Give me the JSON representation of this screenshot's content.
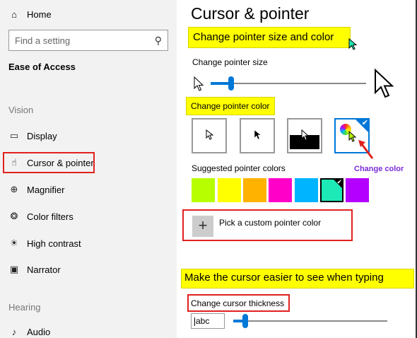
{
  "sidebar": {
    "home_label": "Home",
    "search_placeholder": "Find a setting",
    "category": "Ease of Access",
    "group_vision": "Vision",
    "items": [
      {
        "label": "Display",
        "icon": "monitor-icon"
      },
      {
        "label": "Cursor & pointer",
        "icon": "cursor-hand-icon"
      },
      {
        "label": "Magnifier",
        "icon": "magnifier-icon"
      },
      {
        "label": "Color filters",
        "icon": "color-filters-icon"
      },
      {
        "label": "High contrast",
        "icon": "high-contrast-icon"
      },
      {
        "label": "Narrator",
        "icon": "narrator-icon"
      }
    ],
    "group_hearing": "Hearing",
    "audio_label": "Audio",
    "audio_icon": "speaker-icon"
  },
  "main": {
    "title": "Cursor & pointer",
    "section_pointer": "Change pointer size and color",
    "size_label": "Change pointer size",
    "size_level": 0.13,
    "color_label": "Change pointer color",
    "color_options": [
      "white",
      "black",
      "inverted",
      "custom"
    ],
    "selected_color_option": "custom",
    "annotation_change_color": "Change color",
    "suggested_label": "Suggested pointer colors",
    "suggested_colors": [
      "#b7ff00",
      "#ffff00",
      "#ffb300",
      "#ff00c8",
      "#00b4ff",
      "#1de9b6",
      "#b400ff"
    ],
    "selected_suggested_index": 5,
    "custom_color_label": "Pick a custom pointer color",
    "section_cursor": "Make the cursor easier to see when typing",
    "thickness_label": "Change cursor thickness",
    "thickness_preview": "abc",
    "thickness_level": 0.08
  },
  "colors": {
    "accent": "#0078d7",
    "highlight": "#ffff00",
    "annotation_red": "#e0221f",
    "annotation_purple": "#7a2bd6"
  }
}
